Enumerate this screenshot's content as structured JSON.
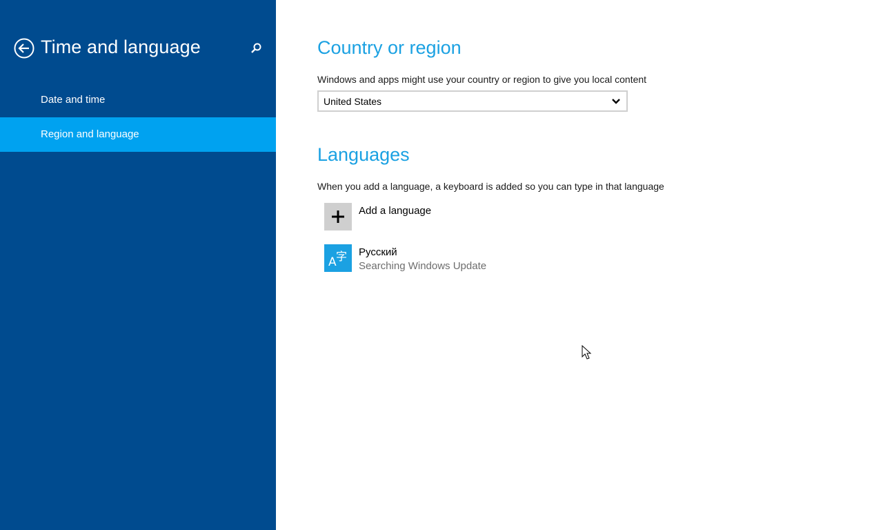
{
  "sidebar": {
    "title": "Time and language",
    "back_icon": "back-arrow-icon",
    "search_icon": "search-icon",
    "items": [
      {
        "label": "Date and time",
        "selected": false
      },
      {
        "label": "Region and language",
        "selected": true
      }
    ]
  },
  "country_section": {
    "heading": "Country or region",
    "description": "Windows and apps might use your country or region to give you local content",
    "selected_country": "United States"
  },
  "languages_section": {
    "heading": "Languages",
    "description": "When you add a language, a keyboard is added so you can type in that language",
    "add_label": "Add a language",
    "languages": [
      {
        "name": "Русский",
        "status": "Searching Windows Update",
        "tile_glyph_latin": "A",
        "tile_glyph_cjk": "字"
      }
    ]
  },
  "colors": {
    "sidebar_bg": "#004b8f",
    "selected_item_bg": "#00a2f0",
    "accent": "#1ba1e2",
    "add_tile_bg": "#cfcfcf"
  }
}
